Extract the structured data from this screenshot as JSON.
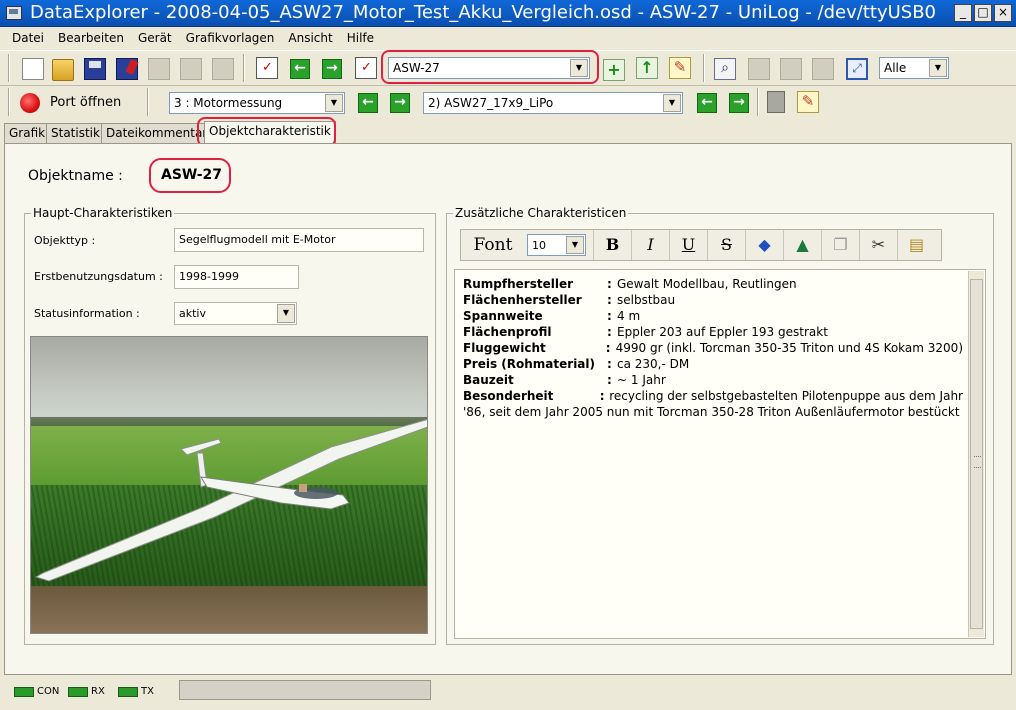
{
  "window": {
    "title": "DataExplorer  -  2008-04-05_ASW27_Motor_Test_Akku_Vergleich.osd  -  ASW-27  -  UniLog  -  /dev/ttyUSB0",
    "min": "_",
    "max": "□",
    "close": "×"
  },
  "menu": [
    "Datei",
    "Bearbeiten",
    "Gerät",
    "Grafikvorlagen",
    "Ansicht",
    "Hilfe"
  ],
  "toolbar": {
    "object_select": "ASW-27",
    "zoom_select": "Alle",
    "port_label": "Port öffnen",
    "channel_select": "3 : Motormessung",
    "record_select": "2) ASW27_17x9_LiPo"
  },
  "tabs": [
    "Grafik",
    "Statistik",
    "Dateikommentar",
    "Objektcharakteristik"
  ],
  "object": {
    "name_label": "Objektname :",
    "name_value": "ASW-27"
  },
  "main_group": {
    "legend": "Haupt-Charakteristiken",
    "type_label": "Objekttyp :",
    "type_value": "Segelflugmodell mit E-Motor",
    "date_label": "Erstbenutzungsdatum :",
    "date_value": "1998-1999",
    "status_label": "Statusinformation :",
    "status_value": "aktiv"
  },
  "extra_group": {
    "legend": "Zusätzliche Charakteristicen",
    "font_label": "Font",
    "font_size": "10",
    "bold": "B",
    "italic": "I",
    "underline": "U",
    "strike": "S",
    "rows": [
      {
        "key": "Rumpfhersteller",
        "value": "Gewalt Modellbau, Reutlingen"
      },
      {
        "key": "Flächenhersteller",
        "value": "selbstbau"
      },
      {
        "key": "Spannweite",
        "value": "4 m"
      },
      {
        "key": "Flächenprofil",
        "value": "Eppler 203 auf Eppler 193 gestrakt"
      },
      {
        "key": "Fluggewicht",
        "value": "4990 gr (inkl. Torcman 350-35 Triton und 4S Kokam 3200)"
      },
      {
        "key": "Preis (Rohmaterial)",
        "value": "ca 230,- DM"
      },
      {
        "key": "Bauzeit",
        "value": "~ 1 Jahr"
      },
      {
        "key": "Besonderheit",
        "value": "recycling der selbstgebastelten Pilotenpuppe aus dem Jahr"
      }
    ],
    "continuation": "'86, seit dem Jahr 2005 nun mit Torcman 350-28 Triton Außenläufermotor bestückt"
  },
  "status": {
    "con": "CON",
    "rx": "RX",
    "tx": "TX"
  },
  "colors": {
    "highlight": "#e02040",
    "lamp": "#2a9a2a",
    "title_bar": "#0a4fb0"
  }
}
